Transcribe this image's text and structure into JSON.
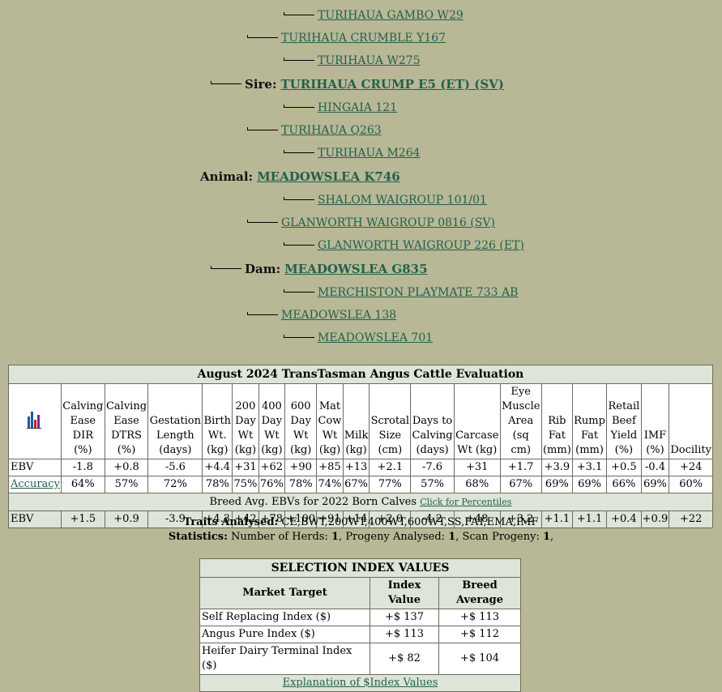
{
  "pedigree": {
    "sire_sire_sire": "TURIHAUA GAMBO W29",
    "sire_sire": "TURIHAUA CRUMBLE Y167",
    "sire_sire_dam": "TURIHAUA W275",
    "sire_label": "Sire:",
    "sire": "TURIHAUA CRUMP E5 (ET) (SV)",
    "sire_dam_sire": "HINGAIA 121",
    "sire_dam": "TURIHAUA Q263",
    "sire_dam_dam": "TURIHAUA M264",
    "animal_label": "Animal:",
    "animal": "MEADOWSLEA K746",
    "dam_sire_sire": "SHALOM WAIGROUP 101/01",
    "dam_sire": "GLANWORTH WAIGROUP 0816 (SV)",
    "dam_sire_dam": "GLANWORTH WAIGROUP 226 (ET)",
    "dam_label": "Dam:",
    "dam": "MEADOWSLEA G835",
    "dam_dam_sire": "MERCHISTON PLAYMATE 733 AB",
    "dam_dam": "MEADOWSLEA 138",
    "dam_dam_dam": "MEADOWSLEA 701"
  },
  "ebv_table": {
    "title": "August 2024 TransTasman Angus Cattle Evaluation",
    "icon": "bar-chart-icon",
    "headers": [
      "Calving Ease DIR (%)",
      "Calving Ease DTRS (%)",
      "Gestation Length (days)",
      "Birth Wt. (kg)",
      "200 Day Wt (kg)",
      "400 Day Wt (kg)",
      "600 Day Wt (kg)",
      "Mat Cow Wt (kg)",
      "Milk (kg)",
      "Scrotal Size (cm)",
      "Days to Calving (days)",
      "Carcase Wt (kg)",
      "Eye Muscle Area (sq cm)",
      "Rib Fat (mm)",
      "Rump Fat (mm)",
      "Retail Beef Yield (%)",
      "IMF (%)",
      "Docility"
    ],
    "ebv_label": "EBV",
    "ebv": [
      "-1.8",
      "+0.8",
      "-5.6",
      "+4.4",
      "+31",
      "+62",
      "+90",
      "+85",
      "+13",
      "+2.1",
      "-7.6",
      "+31",
      "+1.7",
      "+3.9",
      "+3.1",
      "+0.5",
      "-0.4",
      "+24"
    ],
    "accuracy_label": "Accuracy",
    "accuracy": [
      "64%",
      "57%",
      "72%",
      "78%",
      "75%",
      "76%",
      "78%",
      "74%",
      "67%",
      "77%",
      "57%",
      "68%",
      "67%",
      "69%",
      "69%",
      "66%",
      "69%",
      "60%"
    ],
    "breed_avg_text": "Breed Avg. EBVs for 2022 Born Calves",
    "percentiles_link": "Click for Percentiles",
    "breed_label": "EBV",
    "breed_avg": [
      "+1.5",
      "+0.9",
      "-3.9",
      "+4.3",
      "+42",
      "+78",
      "+100",
      "+91",
      "+14",
      "+2.0",
      "-4.2",
      "+48",
      "+3.2",
      "+1.1",
      "+1.1",
      "+0.4",
      "+0.9",
      "+22"
    ]
  },
  "traits": {
    "analysed_label": "Traits Analysed:",
    "analysed_value": "CE,BWT,200WT,400WT,600WT,SS,FAT,EMA,IMF",
    "stats_label": "Statistics:",
    "herds_label": "Number of Herds:",
    "herds": "1",
    "progeny_label": "Progeny Analysed:",
    "progeny": "1",
    "scan_label": "Scan Progeny:",
    "scan": "1"
  },
  "selection": {
    "title": "SELECTION INDEX VALUES",
    "col_market": "Market Target",
    "col_index": "Index Value",
    "col_breed": "Breed Average",
    "rows": [
      {
        "target": "Self Replacing Index ($)",
        "index": "+$ 137",
        "breed": "+$ 113"
      },
      {
        "target": "Angus Pure Index ($)",
        "index": "+$ 113",
        "breed": "+$ 112"
      },
      {
        "target": "Heifer Dairy Terminal Index ($)",
        "index": "+$ 82",
        "breed": "+$ 104"
      }
    ],
    "footer_link": "Explanation of $Index Values"
  }
}
